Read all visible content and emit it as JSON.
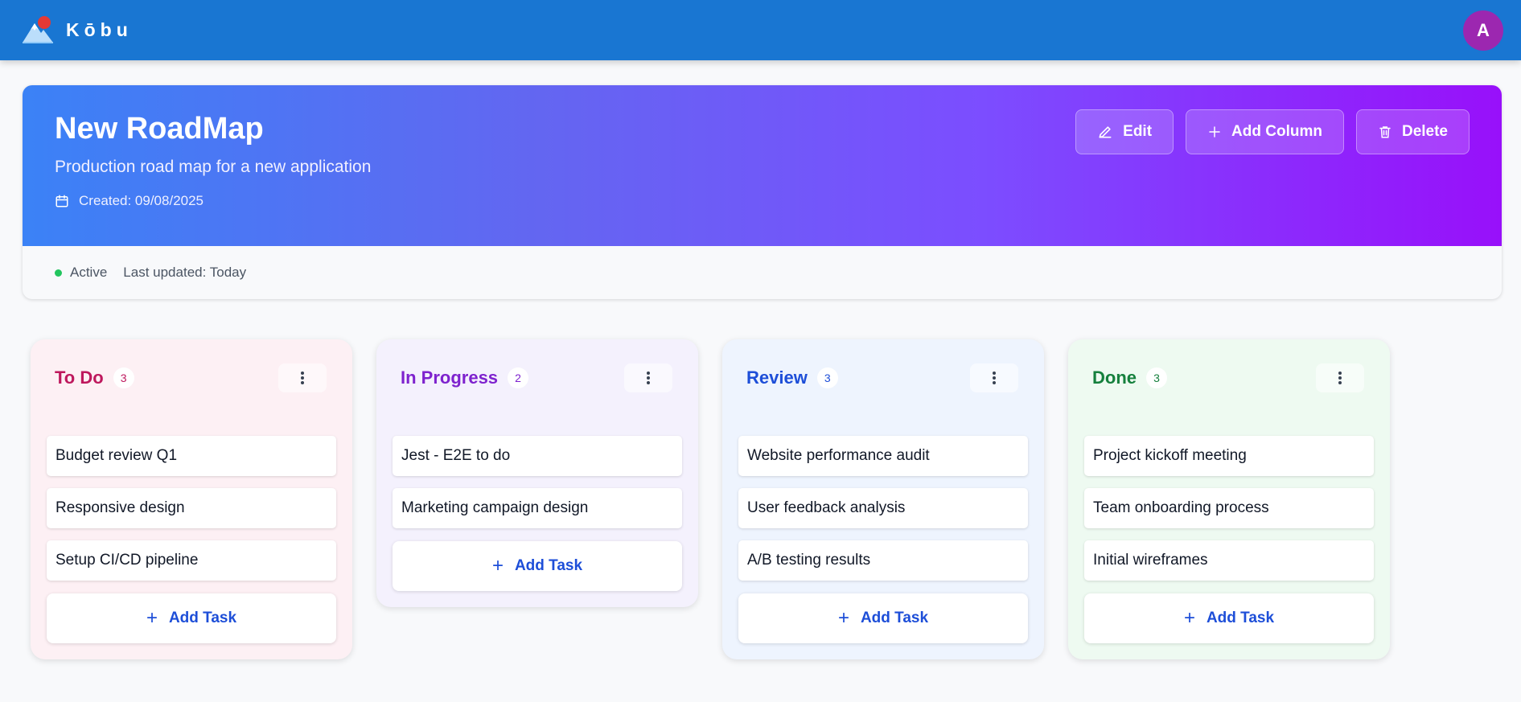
{
  "app": {
    "name": "Kōbu",
    "avatar_initial": "A",
    "logo_icon": "mountain-sun-icon",
    "colors": {
      "topbar": "#1976d2",
      "avatar": "#9c27b0"
    }
  },
  "roadmap": {
    "title": "New RoadMap",
    "description": "Production road map for a new application",
    "created": "Created: 09/08/2025",
    "status": "Active",
    "last_updated": "Last updated: Today",
    "actions": {
      "edit": "Edit",
      "add_column": "Add Column",
      "delete": "Delete"
    }
  },
  "columns": [
    {
      "title": "To Do",
      "count": "3",
      "color": "#be185d",
      "bg": "#fdf0f4",
      "tasks": [
        "Budget review Q1",
        "Responsive design",
        "Setup CI/CD pipeline"
      ],
      "add_label": "Add Task"
    },
    {
      "title": "In Progress",
      "count": "2",
      "color": "#7e22ce",
      "bg": "#f4f1fd",
      "tasks": [
        "Jest - E2E to do",
        "Marketing campaign design"
      ],
      "add_label": "Add Task"
    },
    {
      "title": "Review",
      "count": "3",
      "color": "#1d4ed8",
      "bg": "#eef4fe",
      "tasks": [
        "Website performance audit",
        "User feedback analysis",
        "A/B testing results"
      ],
      "add_label": "Add Task"
    },
    {
      "title": "Done",
      "count": "3",
      "color": "#15803d",
      "bg": "#eefaf1",
      "tasks": [
        "Project kickoff meeting",
        "Team onboarding process",
        "Initial wireframes"
      ],
      "add_label": "Add Task"
    }
  ]
}
